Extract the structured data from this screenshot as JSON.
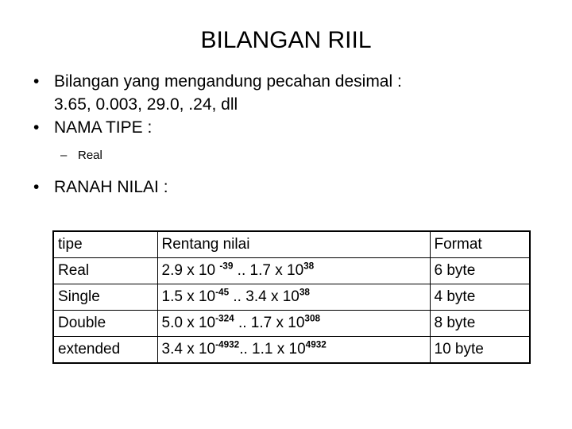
{
  "slide": {
    "title": "BILANGAN RIIL",
    "bullets": [
      {
        "level": 1,
        "marker": "•",
        "text": "Bilangan yang mengandung pecahan desimal :",
        "continuation": "3.65, 0.003, 29.0, .24, dll"
      },
      {
        "level": 1,
        "marker": "•",
        "text": "NAMA TIPE :"
      },
      {
        "level": 2,
        "marker": "–",
        "text": "Real"
      },
      {
        "level": 1,
        "marker": "•",
        "text": "RANAH NILAI :"
      }
    ]
  },
  "table": {
    "headers": [
      "tipe",
      "Rentang nilai",
      "Format"
    ],
    "rows": [
      {
        "tipe": "Real",
        "range": {
          "low_mantissa": "2.9 x 10 ",
          "low_exponent": "-39",
          "separator": "  ..  ",
          "high_mantissa": "1.7 x 10",
          "high_exponent": "38",
          "plain": "2.9 x 10 -39 .. 1.7 x 10 38"
        },
        "format": "6 byte"
      },
      {
        "tipe": "Single",
        "range": {
          "low_mantissa": "1.5 x 10",
          "low_exponent": "-45",
          "separator": "   ..  ",
          "high_mantissa": "3.4 x 10",
          "high_exponent": "38",
          "plain": "1.5 x 10 -45 .. 3.4 x 10 38"
        },
        "format": "4 byte"
      },
      {
        "tipe": "Double",
        "range": {
          "low_mantissa": "5.0 x 10",
          "low_exponent": "-324",
          "separator": "  ..  ",
          "high_mantissa": "1.7 x 10",
          "high_exponent": "308",
          "plain": "5.0 x 10 -324 .. 1.7 x 10 308"
        },
        "format": "8 byte"
      },
      {
        "tipe": "extended",
        "range": {
          "low_mantissa": "3.4 x 10",
          "low_exponent": "-4932",
          "separator": ".. ",
          "high_mantissa": "1.1 x 10",
          "high_exponent": "4932",
          "plain": "3.4 x 10 -4932 .. 1.1 x 10 4932"
        },
        "format": "10 byte"
      }
    ]
  },
  "colors": {
    "background": "#ffffff",
    "text": "#000000",
    "table_border": "#000000"
  }
}
